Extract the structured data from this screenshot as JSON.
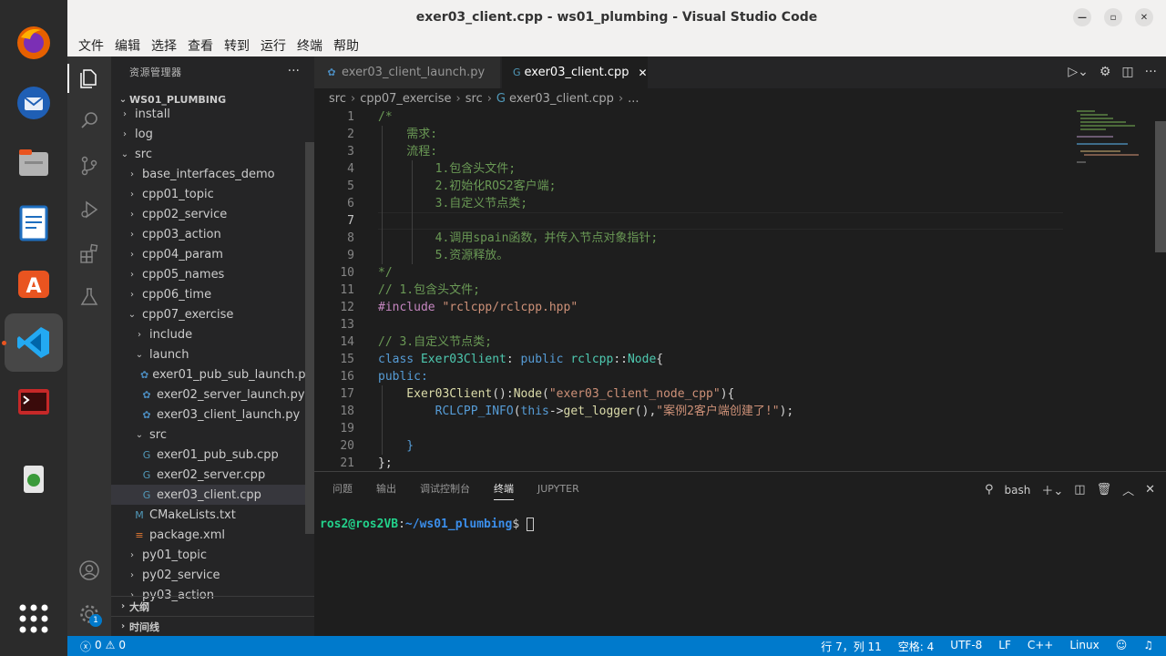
{
  "window": {
    "title": "exer03_client.cpp - ws01_plumbing - Visual Studio Code"
  },
  "menu": [
    "文件",
    "编辑",
    "选择",
    "查看",
    "转到",
    "运行",
    "终端",
    "帮助"
  ],
  "sidebar": {
    "header": "资源管理器",
    "workspace": "WS01_PLUMBING",
    "tree": [
      {
        "label": "install",
        "chev": "›",
        "indent": 1
      },
      {
        "label": "log",
        "chev": "›",
        "indent": 1
      },
      {
        "label": "src",
        "chev": "⌄",
        "indent": 1
      },
      {
        "label": "base_interfaces_demo",
        "chev": "›",
        "indent": 2
      },
      {
        "label": "cpp01_topic",
        "chev": "›",
        "indent": 2
      },
      {
        "label": "cpp02_service",
        "chev": "›",
        "indent": 2
      },
      {
        "label": "cpp03_action",
        "chev": "›",
        "indent": 2
      },
      {
        "label": "cpp04_param",
        "chev": "›",
        "indent": 2
      },
      {
        "label": "cpp05_names",
        "chev": "›",
        "indent": 2
      },
      {
        "label": "cpp06_time",
        "chev": "›",
        "indent": 2
      },
      {
        "label": "cpp07_exercise",
        "chev": "⌄",
        "indent": 2
      },
      {
        "label": "include",
        "chev": "›",
        "indent": 3
      },
      {
        "label": "launch",
        "chev": "⌄",
        "indent": 3
      },
      {
        "label": "exer01_pub_sub_launch.py",
        "icon": "python",
        "indent": 4
      },
      {
        "label": "exer02_server_launch.py",
        "icon": "python",
        "indent": 4
      },
      {
        "label": "exer03_client_launch.py",
        "icon": "python",
        "indent": 4
      },
      {
        "label": "src",
        "chev": "⌄",
        "indent": 3
      },
      {
        "label": "exer01_pub_sub.cpp",
        "icon": "cpp",
        "indent": 4
      },
      {
        "label": "exer02_server.cpp",
        "icon": "cpp",
        "indent": 4
      },
      {
        "label": "exer03_client.cpp",
        "icon": "cpp",
        "indent": 4,
        "selected": true
      },
      {
        "label": "CMakeLists.txt",
        "icon": "cmake",
        "indent": 3
      },
      {
        "label": "package.xml",
        "icon": "xml",
        "indent": 3
      },
      {
        "label": "py01_topic",
        "chev": "›",
        "indent": 2
      },
      {
        "label": "py02_service",
        "chev": "›",
        "indent": 2
      },
      {
        "label": "py03_action",
        "chev": "›",
        "indent": 2
      }
    ],
    "outline": "大纲",
    "timeline": "时间线"
  },
  "tabs": [
    {
      "label": "exer03_client_launch.py",
      "active": false
    },
    {
      "label": "exer03_client.cpp",
      "active": true
    }
  ],
  "breadcrumb": [
    "src",
    "cpp07_exercise",
    "src",
    "exer03_client.cpp",
    "..."
  ],
  "editor": {
    "current_line": 7,
    "lines": [
      "1",
      "2",
      "3",
      "4",
      "5",
      "6",
      "7",
      "8",
      "9",
      "10",
      "11",
      "12",
      "13",
      "14",
      "15",
      "16",
      "17",
      "18",
      "19",
      "20",
      "21"
    ],
    "code": {
      "l1": "/*",
      "l2": "    需求:",
      "l3": "    流程:",
      "l4": "        1.包含头文件;",
      "l5": "        2.初始化ROS2客户端;",
      "l6": "        3.自定义节点类;",
      "l8": "        4.调用spain函数，并传入节点对象指针;",
      "l9": "        5.资源释放。",
      "l10": "*/",
      "l11": "// 1.包含头文件;",
      "l12_pp": "#include ",
      "l12_str": "\"rclcpp/rclcpp.hpp\"",
      "l14": "// 3.自定义节点类;",
      "l15_kw": "class ",
      "l15_type": "Exer03Client",
      "l15_p1": ": ",
      "l15_kw2": "public ",
      "l15_ns": "rclcpp",
      "l15_p2": "::",
      "l15_type2": "Node",
      "l15_p3": "{",
      "l16": "public:",
      "l17_fn": "    Exer03Client",
      "l17_p1": "():",
      "l17_fn2": "Node",
      "l17_p2": "(",
      "l17_str": "\"exer03_client_node_cpp\"",
      "l17_p3": "){",
      "l18_mac": "        RCLCPP_INFO",
      "l18_p1": "(",
      "l18_kw": "this",
      "l18_p2": "->",
      "l18_fn": "get_logger",
      "l18_p3": "(),",
      "l18_str": "\"案例2客户端创建了!\"",
      "l18_p4": ");",
      "l20": "    }",
      "l21": "};"
    }
  },
  "panel": {
    "tabs": [
      "问题",
      "输出",
      "调试控制台",
      "终端",
      "JUPYTER"
    ],
    "active_tab": "终端",
    "shell": "bash",
    "prompt_user": "ros2@ros2VB",
    "prompt_sep": ":",
    "prompt_path": "~/ws01_plumbing",
    "prompt_end": "$ "
  },
  "status": {
    "errors": "0",
    "warnings": "0",
    "position": "行 7，列 11",
    "spaces": "空格: 4",
    "encoding": "UTF-8",
    "eol": "LF",
    "language": "C++",
    "os": "Linux"
  },
  "colors": {
    "accent": "#007acc",
    "sidebar_bg": "#252526",
    "editor_bg": "#1e1e1e"
  }
}
